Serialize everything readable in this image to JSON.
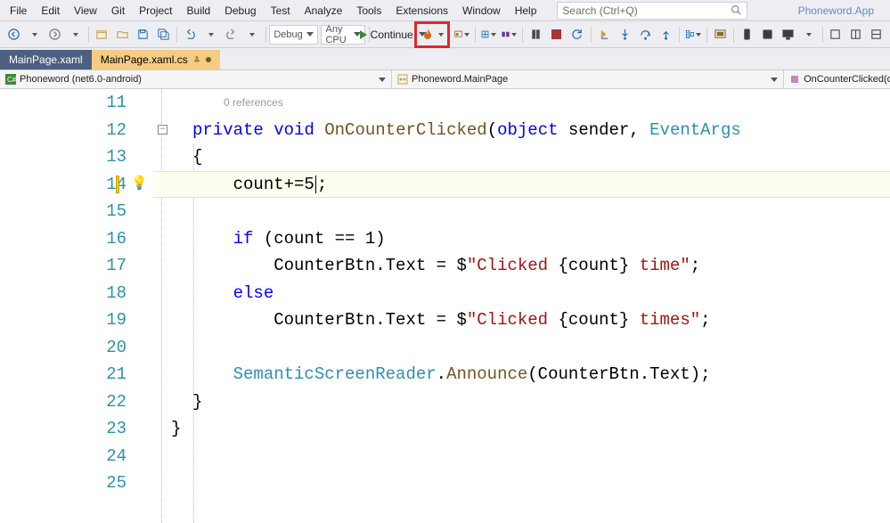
{
  "menu": [
    "File",
    "Edit",
    "View",
    "Git",
    "Project",
    "Build",
    "Debug",
    "Test",
    "Analyze",
    "Tools",
    "Extensions",
    "Window",
    "Help"
  ],
  "search": {
    "placeholder": "Search (Ctrl+Q)"
  },
  "app_title": "Phoneword.App",
  "toolbar": {
    "config": "Debug",
    "platform": "Any CPU",
    "run_label": "Continue"
  },
  "tabs": [
    {
      "label": "MainPage.xaml",
      "active": false
    },
    {
      "label": "MainPage.xaml.cs",
      "active": true,
      "pinned": true,
      "dirty": true
    }
  ],
  "breadcrumb": {
    "project": "Phoneword (net6.0-android)",
    "namespace": "Phoneword.MainPage",
    "member": "OnCounterClicked(ob"
  },
  "codelens": "0 references",
  "lines": {
    "l11": "11",
    "l12": "12",
    "l13": "13",
    "l14": "14",
    "l15": "15",
    "l16": "16",
    "l17": "17",
    "l18": "18",
    "l19": "19",
    "l20": "20",
    "l21": "21",
    "l22": "22",
    "l23": "23",
    "l24": "24",
    "l25": "25"
  },
  "code": {
    "l12_kw1": "private",
    "l12_kw2": "void",
    "l12_method": "OnCounterClicked",
    "l12_p1": "(",
    "l12_kw3": "object",
    "l12_txt1": " sender, ",
    "l12_type": "EventArgs",
    "l13": "{",
    "l14_a": "    count+=5",
    "l14_b": ";",
    "l16_a": "    ",
    "l16_kw": "if",
    "l16_b": " (count == 1)",
    "l17_a": "        CounterBtn.Text = $",
    "l17_s1": "\"Clicked ",
    "l17_i": "{count}",
    "l17_s2": " time\"",
    "l17_b": ";",
    "l18_a": "    ",
    "l18_kw": "else",
    "l19_a": "        CounterBtn.Text = $",
    "l19_s1": "\"Clicked ",
    "l19_i": "{count}",
    "l19_s2": " times\"",
    "l19_b": ";",
    "l21_a": "    ",
    "l21_type": "SemanticScreenReader",
    "l21_b": ".",
    "l21_method": "Announce",
    "l21_c": "(CounterBtn.Text);",
    "l22": "}",
    "l23": "}"
  }
}
